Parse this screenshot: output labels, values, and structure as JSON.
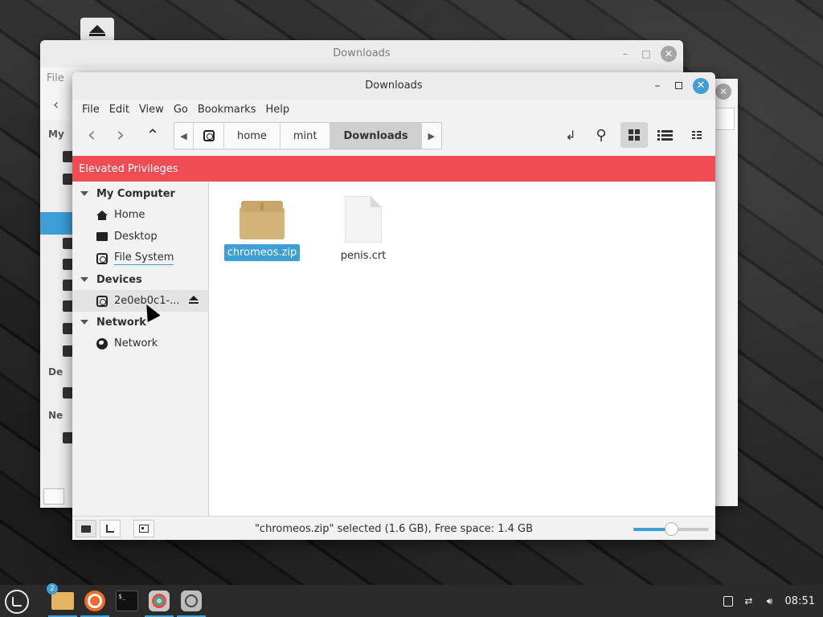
{
  "background_window": {
    "title": "Downloads",
    "menu_first": "File",
    "sidebar_heads": [
      "My",
      "De",
      "Ne"
    ]
  },
  "window": {
    "title": "Downloads",
    "min_label": "–",
    "close_label": "✕"
  },
  "menubar": {
    "items": [
      "File",
      "Edit",
      "View",
      "Go",
      "Bookmarks",
      "Help"
    ]
  },
  "toolbar": {
    "back_glyph": "‹",
    "forward_glyph": "›",
    "up_glyph": "⌃",
    "path_left_glyph": "◀",
    "path_right_glyph": "▶",
    "breadcrumbs": [
      "home",
      "mint",
      "Downloads"
    ],
    "active_crumb": "Downloads",
    "toggle_location_glyph": "↲",
    "search_glyph": "⚲"
  },
  "banner": {
    "text": "Elevated Privileges",
    "color": "#ef4c53"
  },
  "sidebar": {
    "sections": [
      {
        "title": "My Computer",
        "items": [
          "Home",
          "Desktop",
          "File System"
        ]
      },
      {
        "title": "Devices",
        "items": [
          "2e0eb0c1-..."
        ]
      },
      {
        "title": "Network",
        "items": [
          "Network"
        ]
      }
    ]
  },
  "files": [
    {
      "name": "chromeos.zip",
      "type": "archive-icon",
      "selected": true
    },
    {
      "name": "penis.crt",
      "type": "document-icon",
      "selected": false
    }
  ],
  "statusbar": {
    "text": "\"chromeos.zip\" selected (1.6 GB), Free space: 1.4 GB",
    "zoom_level": 0.5
  },
  "taskbar": {
    "badge_count": "2",
    "apps": [
      "folder-icon",
      "firefox-icon",
      "terminal-icon",
      "chromium-icon",
      "disk-icon"
    ],
    "terminal_glyph": "$_",
    "clock": "08:51"
  },
  "colors": {
    "accent": "#3d9fd6",
    "banner": "#ef4c53",
    "taskbar": "#2a2a2a"
  }
}
